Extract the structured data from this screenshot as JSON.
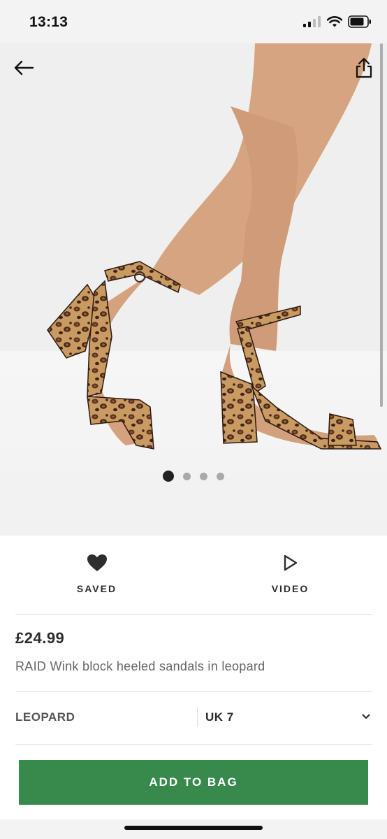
{
  "status_bar": {
    "time": "13:13"
  },
  "product": {
    "price": "£24.99",
    "title": "RAID Wink block heeled sandals in leopard",
    "colour": "LEOPARD",
    "size": "UK 7"
  },
  "actions": {
    "saved_label": "SAVED",
    "video_label": "VIDEO"
  },
  "gallery": {
    "image_count": 4,
    "active_index": 0
  },
  "cta": {
    "add_to_bag_label": "ADD TO BAG"
  },
  "icons": {
    "back": "arrow-left-icon",
    "share": "share-icon",
    "saved": "heart-icon",
    "video": "play-icon",
    "dropdown": "chevron-down-icon"
  },
  "colors": {
    "accent_green": "#388a4c",
    "text_dark": "#2d2d2d"
  }
}
